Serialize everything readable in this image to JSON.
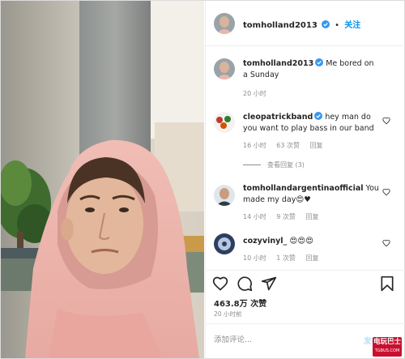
{
  "post": {
    "username": "tomholland2013",
    "follow_label": "关注",
    "separator": "•"
  },
  "caption": {
    "username": "tomholland2013",
    "text": "Me bored on a Sunday",
    "time": "20 小时"
  },
  "comments": [
    {
      "username": "cleopatrickband",
      "text": "hey man do you want to play bass in our band",
      "time": "16 小时",
      "likes": "63 次赞",
      "reply": "回复"
    },
    {
      "username": "tomhollandargentinaofficial",
      "text": "You made my day😍♥",
      "time": "14 小时",
      "likes": "9 次赞",
      "reply": "回复"
    },
    {
      "username": "cozyvinyl_",
      "text": "😍😍😍",
      "time": "10 小时",
      "likes": "1 次赞",
      "reply": "回复"
    }
  ],
  "more_replies": "查看回复 (3)",
  "likes_count": "463.8万 次赞",
  "post_time": "20 小时前",
  "add_comment": {
    "placeholder": "添加评论...",
    "post_label": "发布"
  },
  "watermark": {
    "line1": "电玩巴士",
    "line2": "TGBUS.COM"
  },
  "colors": {
    "link_blue": "#0095f6",
    "verified_blue": "#3897f0",
    "meta_gray": "#8e8e8e",
    "watermark_red": "#c8102e"
  },
  "icons": [
    "verified-badge-icon",
    "heart-icon",
    "comment-icon",
    "share-icon",
    "bookmark-icon"
  ]
}
